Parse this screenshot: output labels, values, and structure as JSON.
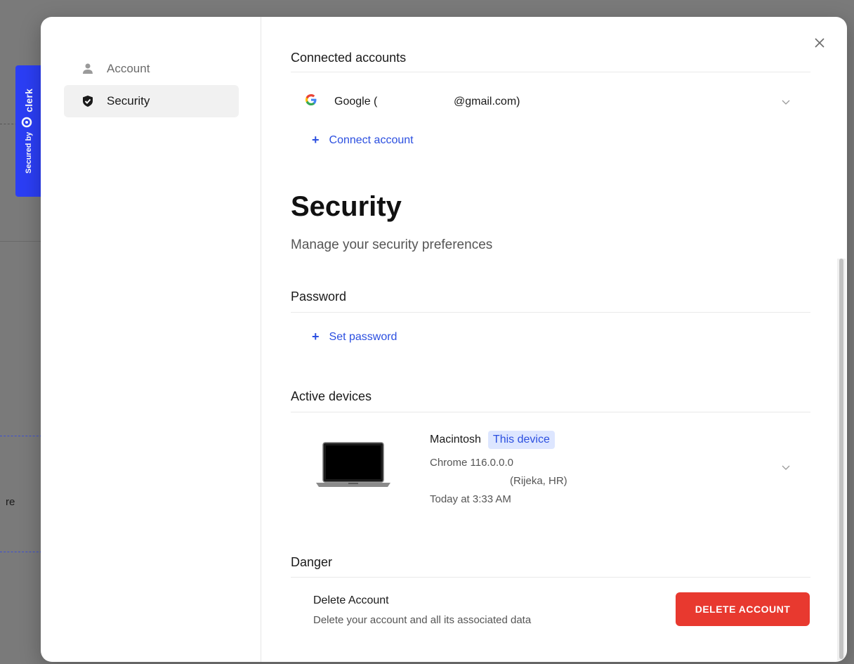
{
  "backdrop": {
    "partial_text": "re"
  },
  "badge": {
    "secured_by": "Secured by",
    "brand": "clerk"
  },
  "sidebar": {
    "items": [
      {
        "label": "Account",
        "icon": "user-icon",
        "active": false
      },
      {
        "label": "Security",
        "icon": "shield-icon",
        "active": true
      }
    ]
  },
  "connected_accounts": {
    "title": "Connected accounts",
    "account_label": "Google (",
    "account_email": "@gmail.com)",
    "connect_label": "Connect account"
  },
  "security": {
    "title": "Security",
    "subtitle": "Manage your security preferences"
  },
  "password": {
    "title": "Password",
    "set_label": "Set password"
  },
  "devices": {
    "title": "Active devices",
    "name": "Macintosh",
    "badge": "This device",
    "browser": "Chrome 116.0.0.0",
    "location": "(Rijeka, HR)",
    "last_active": "Today at 3:33 AM"
  },
  "danger": {
    "title": "Danger",
    "delete_title": "Delete Account",
    "delete_desc": "Delete your account and all its associated data",
    "delete_button": "DELETE ACCOUNT"
  },
  "colors": {
    "accent": "#2b4fe0",
    "danger": "#e8392f",
    "badge": "#2b3ef5"
  }
}
